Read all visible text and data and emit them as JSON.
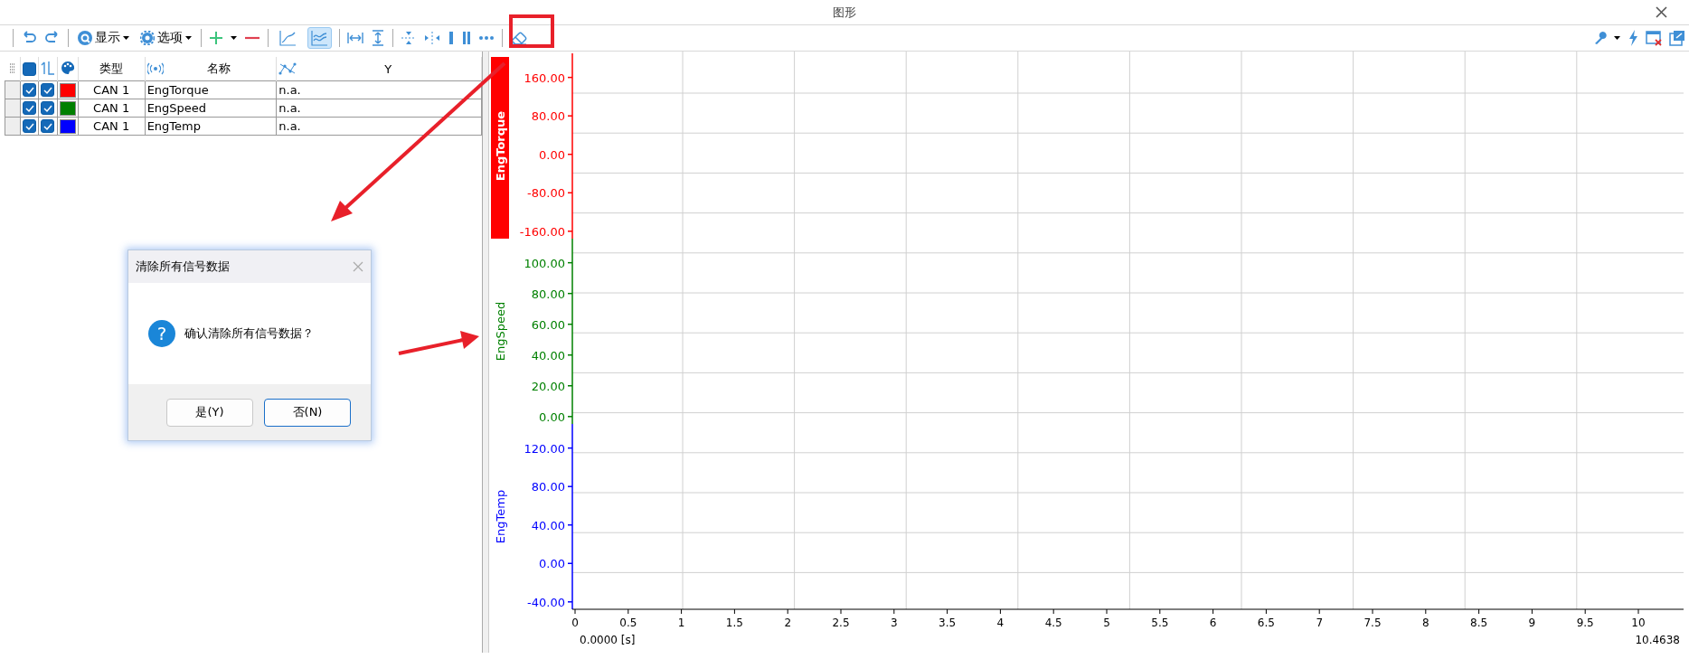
{
  "window": {
    "title": "图形"
  },
  "toolbar": {
    "display_menu": "显示",
    "options_menu": "选项",
    "chart_modes": [
      {
        "kind": "single",
        "selected": false
      },
      {
        "kind": "stacked",
        "selected": true
      }
    ]
  },
  "table": {
    "all_checked": true,
    "columns": [
      "类型",
      "名称",
      "Y"
    ],
    "rows": [
      {
        "visible": true,
        "on_axis": true,
        "color": "#ff0000",
        "type": "CAN 1",
        "name": "EngTorque",
        "y": "n.a."
      },
      {
        "visible": true,
        "on_axis": true,
        "color": "#008000",
        "type": "CAN 1",
        "name": "EngSpeed",
        "y": "n.a."
      },
      {
        "visible": true,
        "on_axis": true,
        "color": "#0000ff",
        "type": "CAN 1",
        "name": "EngTemp",
        "y": "n.a."
      }
    ]
  },
  "plot": {
    "axes": [
      {
        "label": "EngTorque",
        "color": "#ff0000",
        "selected": true,
        "ticks": [
          "160.00",
          "80.00",
          "0.00",
          "-80.00",
          "-160.00"
        ]
      },
      {
        "label": "EngSpeed",
        "color": "#008000",
        "selected": false,
        "ticks": [
          "100.00",
          "80.00",
          "60.00",
          "40.00",
          "20.00",
          "0.00"
        ]
      },
      {
        "label": "EngTemp",
        "color": "#0000ff",
        "selected": false,
        "ticks": [
          "120.00",
          "80.00",
          "40.00",
          "0.00",
          "-40.00"
        ]
      }
    ],
    "x_ticks": [
      "0",
      "0.5",
      "1",
      "1.5",
      "2",
      "2.5",
      "3",
      "3.5",
      "4",
      "4.5",
      "5",
      "5.5",
      "6",
      "6.5",
      "7",
      "7.5",
      "8",
      "8.5",
      "9",
      "9.5",
      "10"
    ],
    "x_start": "0.0000 [s]",
    "x_end": "10.4638"
  },
  "dialog": {
    "title": "清除所有信号数据",
    "icon_glyph": "?",
    "message": "确认清除所有信号数据？",
    "buttons": [
      {
        "label": "是(Y)",
        "selected": false
      },
      {
        "label": "否(N)",
        "selected": true
      }
    ]
  }
}
